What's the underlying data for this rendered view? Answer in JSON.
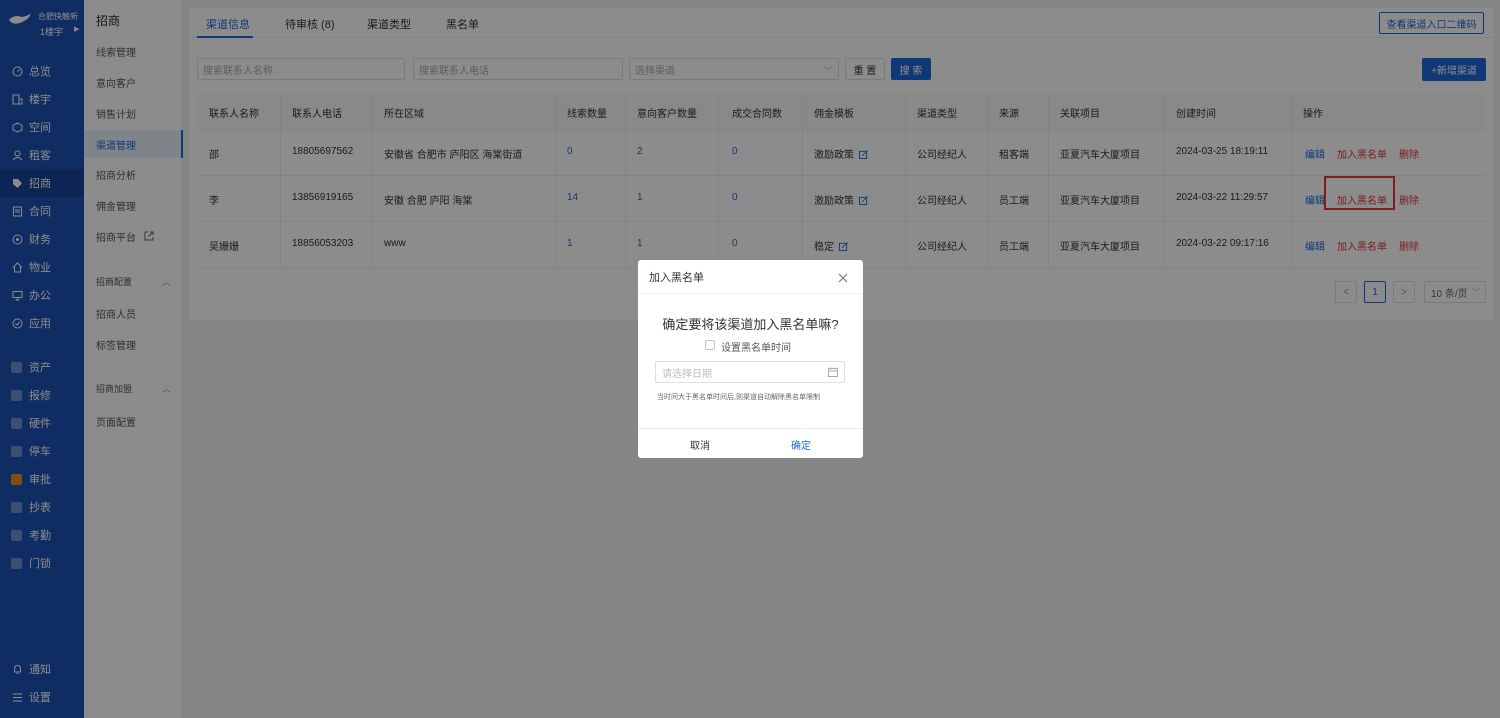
{
  "sidebar": {
    "company": "合肥快触新",
    "user": "1楼宇",
    "items": [
      {
        "label": "总览",
        "icon": "dashboard-icon"
      },
      {
        "label": "楼宇",
        "icon": "building-icon"
      },
      {
        "label": "空间",
        "icon": "cube-icon"
      },
      {
        "label": "租客",
        "icon": "tenant-icon"
      },
      {
        "label": "招商",
        "icon": "tag-icon"
      },
      {
        "label": "合同",
        "icon": "document-icon"
      },
      {
        "label": "财务",
        "icon": "finance-icon"
      },
      {
        "label": "物业",
        "icon": "home-icon"
      },
      {
        "label": "办公",
        "icon": "monitor-icon"
      },
      {
        "label": "应用",
        "icon": "app-icon"
      }
    ],
    "modules": [
      {
        "label": "资产"
      },
      {
        "label": "报修"
      },
      {
        "label": "硬件"
      },
      {
        "label": "停车"
      },
      {
        "label": "审批"
      },
      {
        "label": "抄表"
      },
      {
        "label": "考勤"
      },
      {
        "label": "门锁"
      }
    ],
    "bottom": [
      {
        "label": "通知",
        "icon": "bell-icon"
      },
      {
        "label": "设置",
        "icon": "menu-icon"
      }
    ]
  },
  "submenu": {
    "title": "招商",
    "items": [
      "线索管理",
      "意向客户",
      "销售计划",
      "渠道管理",
      "招商分析",
      "佣金管理",
      "招商平台"
    ],
    "group1": "招商配置",
    "group1_items": [
      "招商人员",
      "标签管理"
    ],
    "group2": "招商加盟",
    "group2_items": [
      "页面配置"
    ]
  },
  "tabs": [
    "渠道信息",
    "待审核 (8)",
    "渠道类型",
    "黑名单"
  ],
  "qr_button": "查看渠道入口二维码",
  "filters": {
    "name_placeholder": "搜索联系人名称",
    "phone_placeholder": "搜索联系人电话",
    "channel_placeholder": "选择渠道",
    "reset": "重 置",
    "search": "搜 索",
    "add": "+新增渠道"
  },
  "table": {
    "headers": [
      "联系人名称",
      "联系人电话",
      "所在区域",
      "线索数量",
      "意向客户数量",
      "成交合同数",
      "佣金模板",
      "渠道类型",
      "来源",
      "关联项目",
      "创建时间",
      "操作"
    ],
    "rows": [
      {
        "name": "邵",
        "phone": "18805697562",
        "region": "安徽省 合肥市 庐阳区 海棠街道",
        "leads": "0",
        "intent": "2",
        "deals": "0",
        "template": "激励政策",
        "type": "公司经纪人",
        "source": "租客端",
        "project": "亚夏汽车大厦项目",
        "created": "2024-03-25 18:19:11"
      },
      {
        "name": "李",
        "phone": "13856919165",
        "region": "安徽 合肥 庐阳 海棠",
        "leads": "14",
        "intent": "1",
        "deals": "0",
        "template": "激励政策",
        "type": "公司经纪人",
        "source": "员工端",
        "project": "亚夏汽车大厦项目",
        "created": "2024-03-22 11:29:57"
      },
      {
        "name": "吴姗姗",
        "phone": "18856053203",
        "region": "www",
        "leads": "1",
        "intent": "1",
        "deals": "0",
        "template": "稳定",
        "type": "公司经纪人",
        "source": "员工端",
        "project": "亚夏汽车大厦项目",
        "created": "2024-03-22 09:17:16"
      }
    ],
    "actions": {
      "edit": "编辑",
      "blacklist": "加入黑名单",
      "delete": "删除"
    }
  },
  "pagination": {
    "current": "1",
    "prev": "<",
    "next": ">",
    "size": "10 条/页"
  },
  "modal": {
    "title": "加入黑名单",
    "question": "确定要将该渠道加入黑名单嘛?",
    "checkbox_label": "设置黑名单时间",
    "date_placeholder": "请选择日期",
    "hint": "当时间大于黑名单时间后,则渠道自动解除黑名单限制",
    "cancel": "取消",
    "ok": "确定"
  },
  "colors": {
    "brand": "#1e53b5",
    "primary": "#1e66d8",
    "danger": "#e0363c"
  }
}
